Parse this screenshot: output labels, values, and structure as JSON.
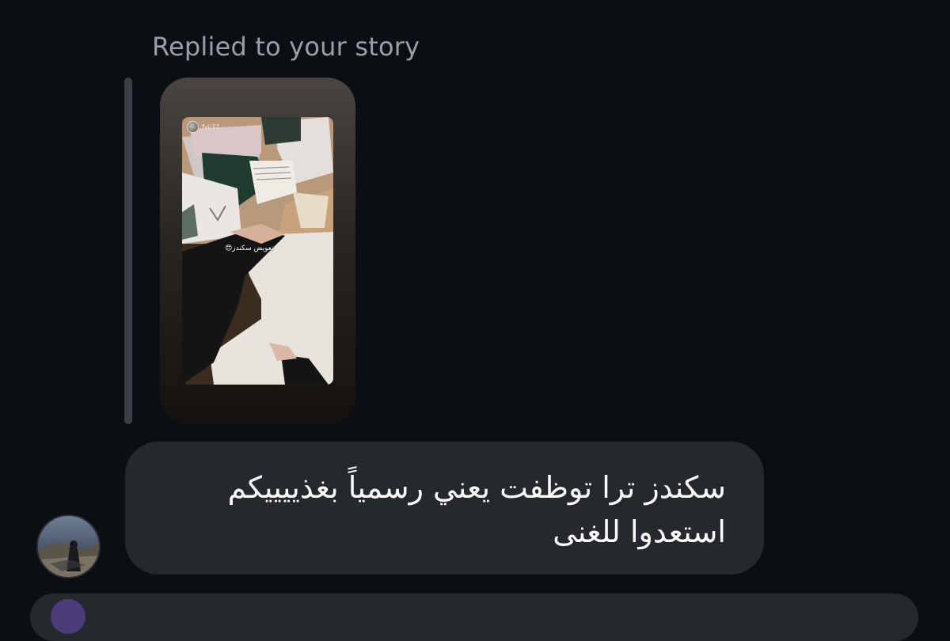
{
  "reply": {
    "label": "Replied to your story"
  },
  "story": {
    "username": "fvii37",
    "caption": "تعويض سكندز😍"
  },
  "message": {
    "line1": "سكندز ترا توظفت يعني رسمياً بغذييييكم",
    "line2": "استعدوا للغنى"
  },
  "colors": {
    "background": "#0b0f14",
    "bubble": "#25282d",
    "label_text": "#9aa0a8"
  },
  "icons": {
    "sender": "user-avatar",
    "next_sender": "user-avatar"
  }
}
